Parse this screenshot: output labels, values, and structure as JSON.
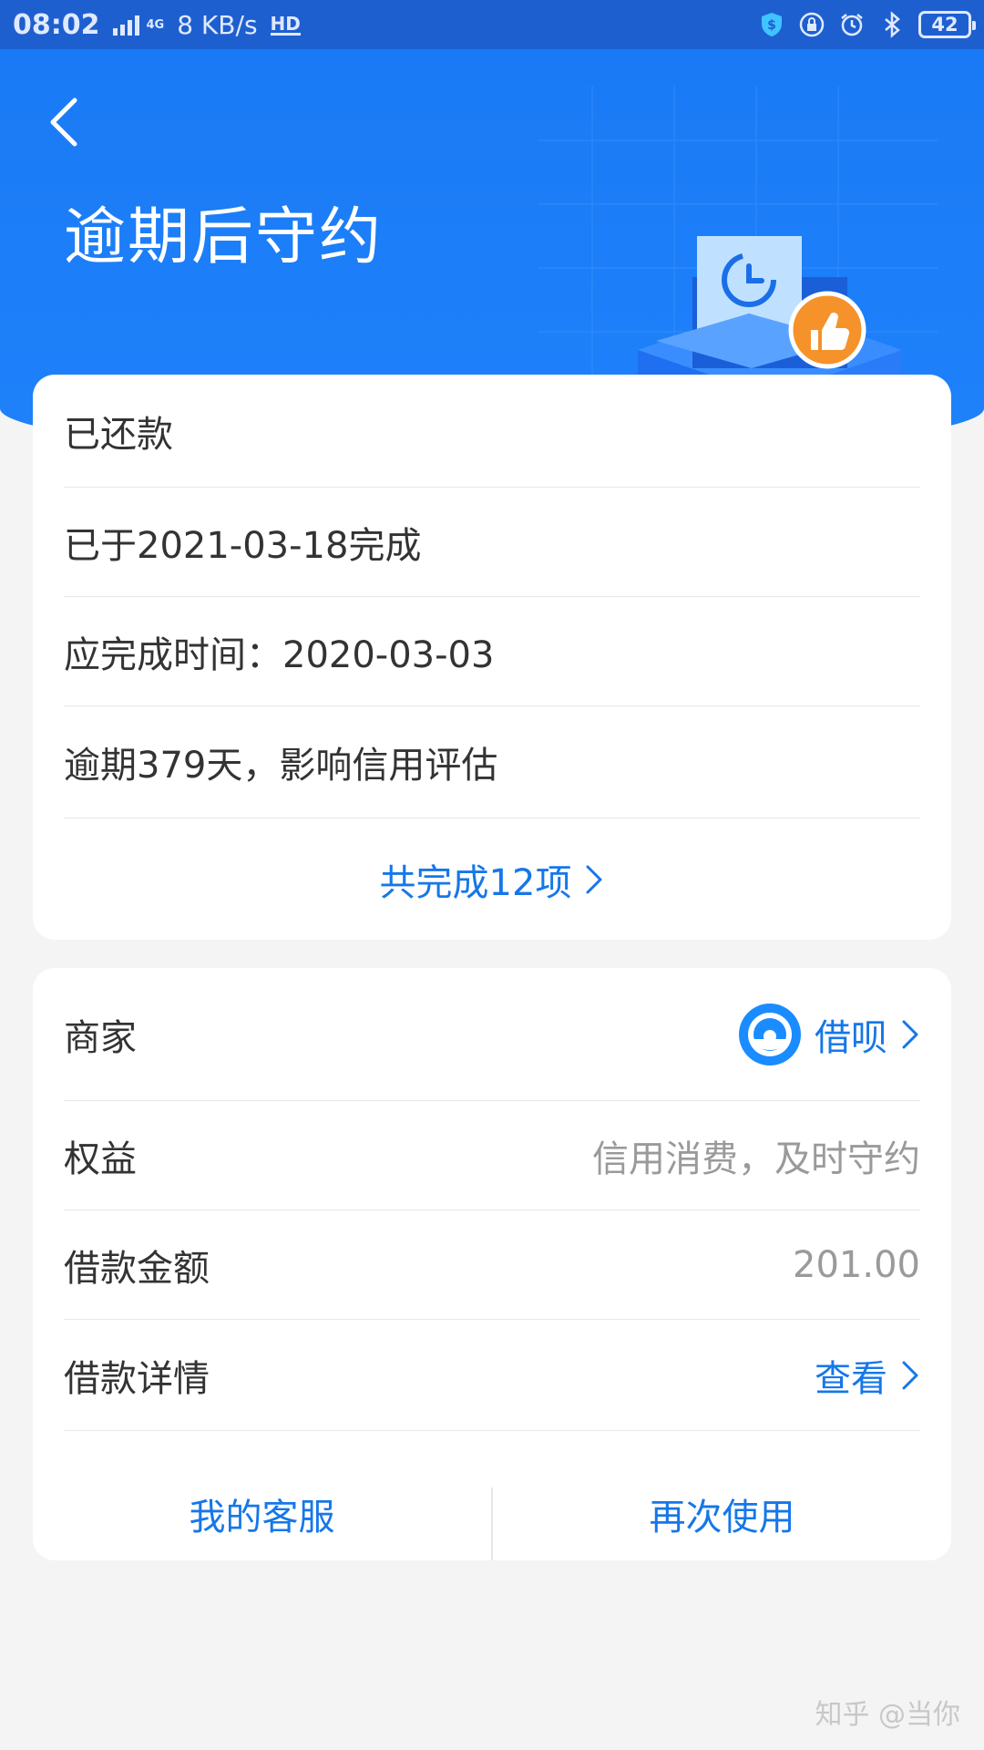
{
  "status_bar": {
    "time": "08:02",
    "network": "4G",
    "speed": "8 KB/s",
    "hd": "HD",
    "battery": "42",
    "icons": [
      "shield-dollar-icon",
      "lock-rotation-icon",
      "alarm-icon",
      "bluetooth-icon"
    ]
  },
  "header": {
    "back_icon": "chevron-left-icon",
    "title": "逾期后守约",
    "illustration": "calendar-clock-thumbs-up-illustration",
    "colors": {
      "background": "#1e82fb",
      "badge": "#f5922a"
    }
  },
  "status_card": {
    "heading": "已还款",
    "completed": "已于2021-03-18完成",
    "due": "应完成时间：2020-03-03",
    "overdue": "逾期379天，影响信用评估",
    "summary_link": "共完成12项"
  },
  "detail_card": {
    "merchant": {
      "label": "商家",
      "value": "借呗",
      "logo": "jiebei-logo-icon"
    },
    "benefit": {
      "label": "权益",
      "value": "信用消费，及时守约"
    },
    "amount": {
      "label": "借款金额",
      "value": "201.00"
    },
    "details": {
      "label": "借款详情",
      "value": "查看"
    },
    "actions": {
      "service": "我的客服",
      "reuse": "再次使用"
    },
    "accent_color": "#1677e8"
  },
  "watermark": "知乎 @当你"
}
